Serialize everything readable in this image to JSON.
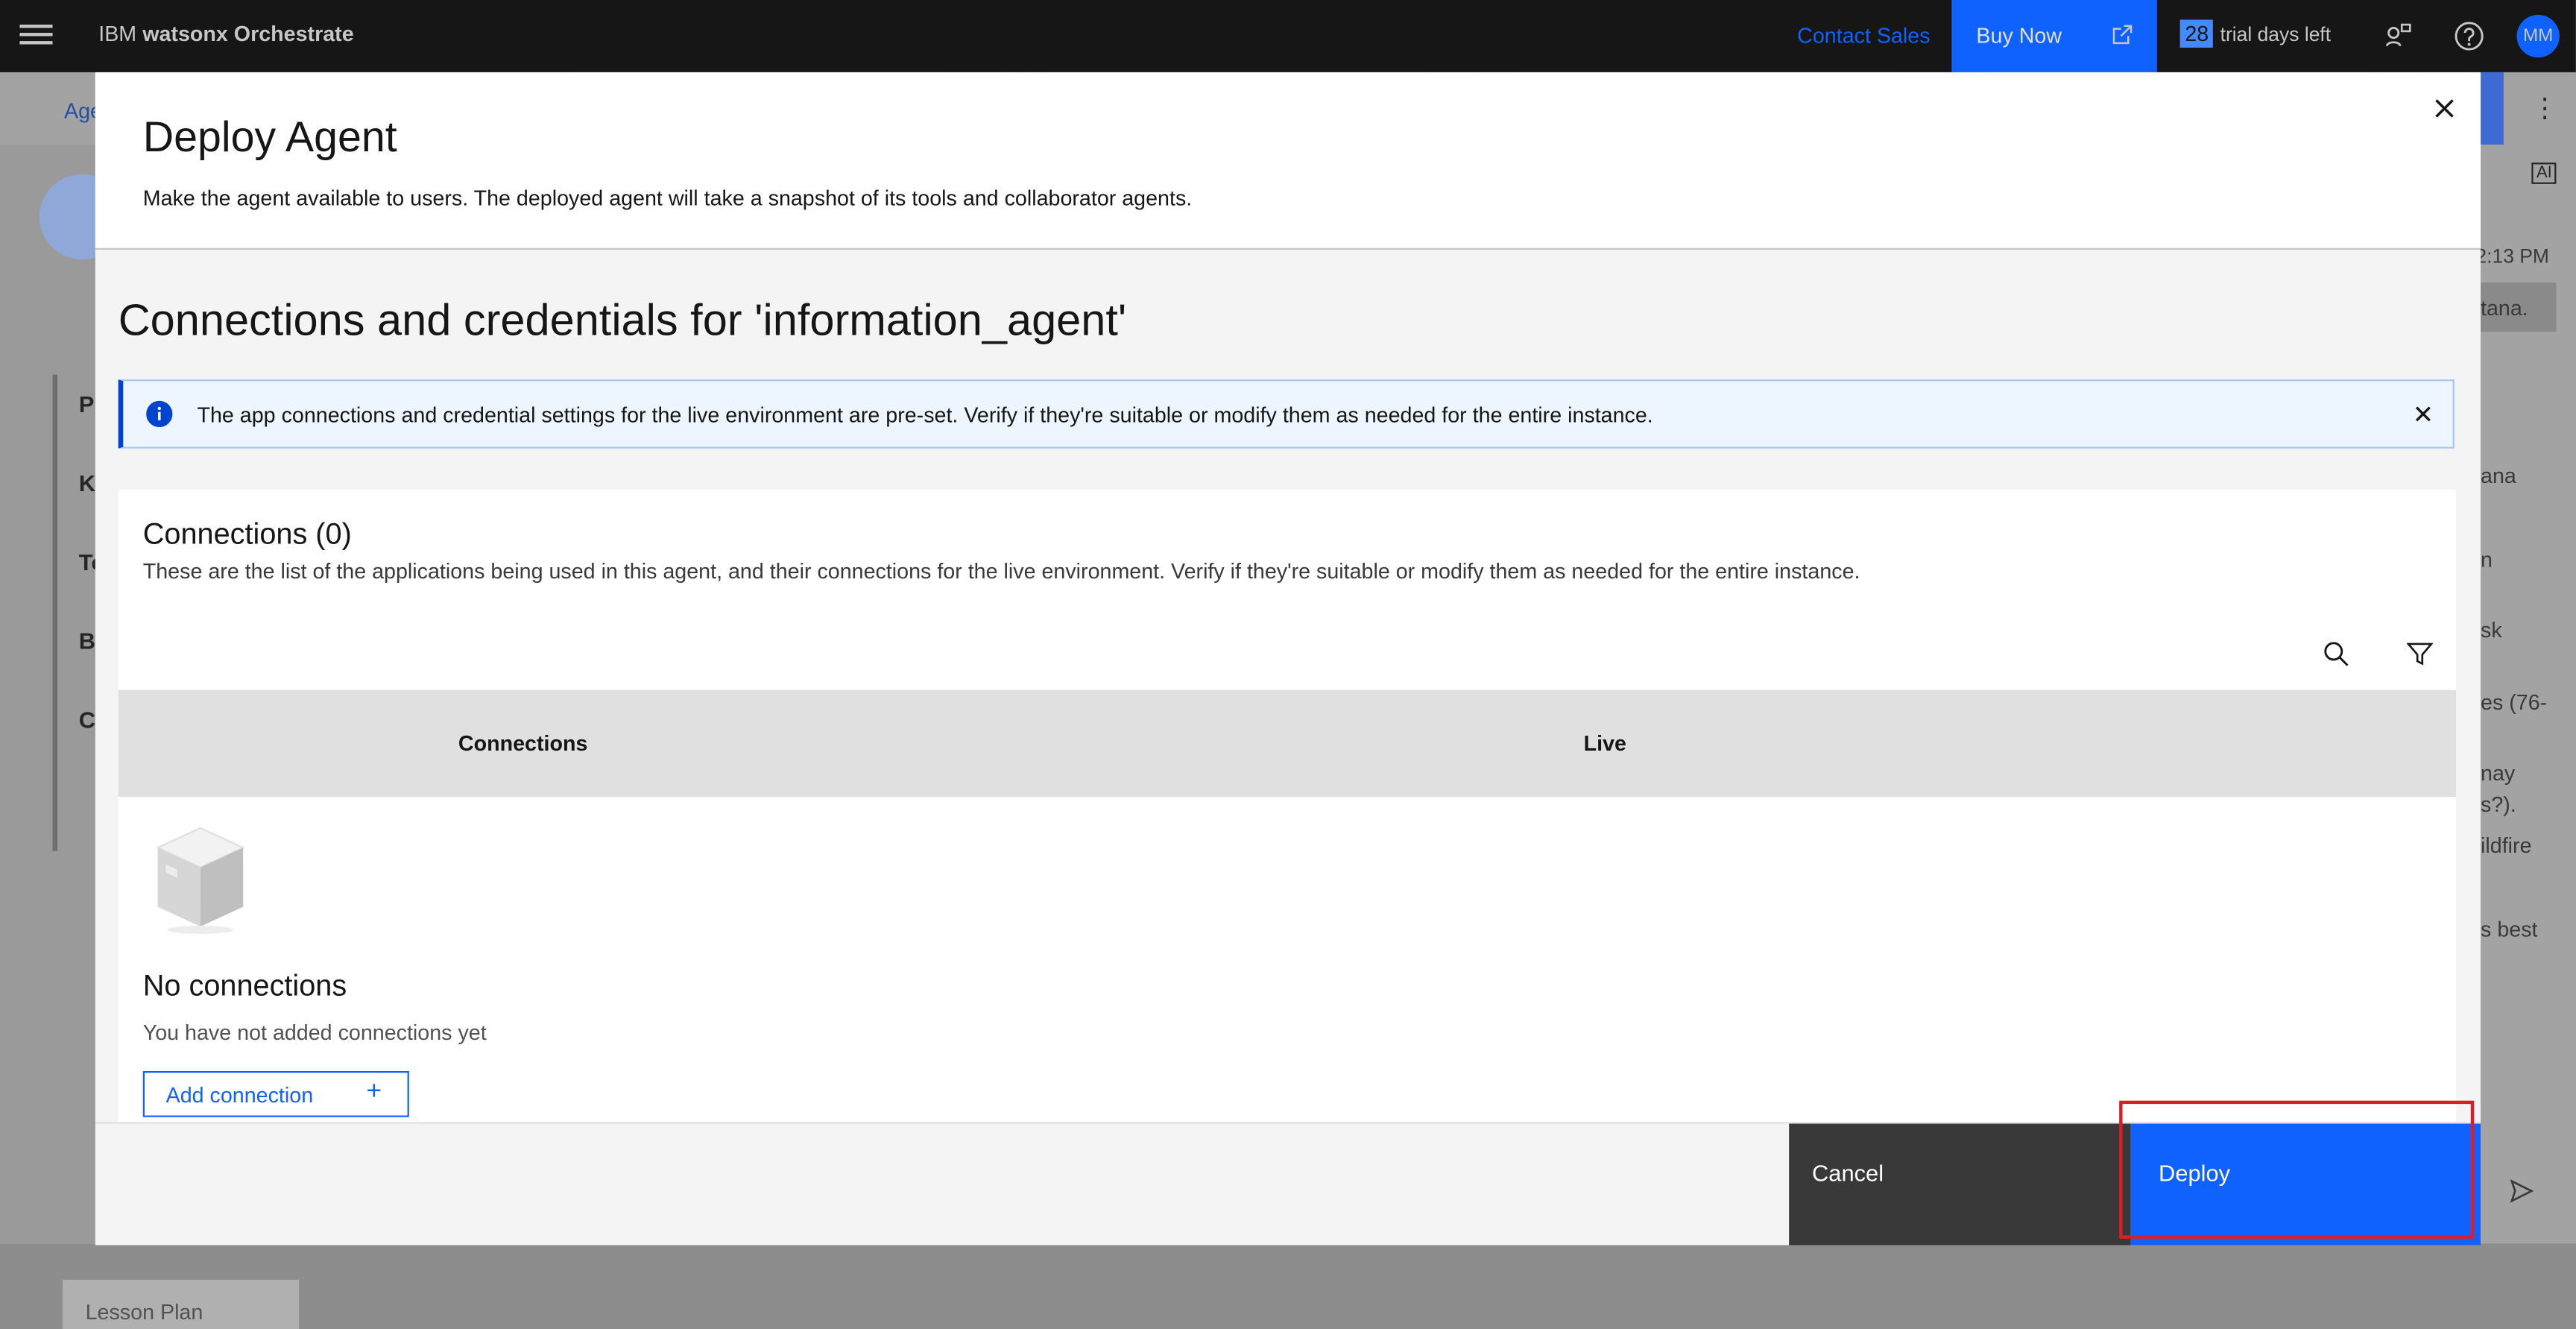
{
  "topbar": {
    "brand_prefix": "IBM",
    "brand_name": "watsonx Orchestrate",
    "contact_sales": "Contact Sales",
    "buy_now": "Buy Now",
    "trial_days": "28",
    "trial_text": "trial days left",
    "avatar_initials": "MM"
  },
  "background": {
    "crumb": "Age",
    "nav_items": [
      "P",
      "K",
      "To",
      "Be",
      "Cl"
    ],
    "right_snippets": [
      "2:13 PM",
      "tana.",
      "ana",
      "n",
      "sk",
      "es (76-",
      "nay",
      "s?).",
      "ildfire",
      "s best"
    ],
    "ai_badge": "AI",
    "lesson_tab": "Lesson Plan"
  },
  "modal": {
    "title": "Deploy Agent",
    "description": "Make the agent available to users. The deployed agent will take a snapshot of its tools and collaborator agents.",
    "section_title": "Connections and credentials for 'information_agent'",
    "notice": "The app connections and credential settings for the live environment are pre-set. Verify if they're suitable or modify them as needed for the entire instance.",
    "connections": {
      "heading": "Connections (0)",
      "description": "These are the list of the applications being used in this agent, and their connections for the live environment. Verify if they're suitable or modify them as needed for the entire instance.",
      "columns": [
        "Connections",
        "Live"
      ],
      "empty_title": "No connections",
      "empty_desc": "You have not added connections yet",
      "add_button": "Add connection",
      "add_icon": "+"
    },
    "footer": {
      "cancel": "Cancel",
      "deploy": "Deploy"
    }
  },
  "colors": {
    "primary": "#0f62fe",
    "shell": "#161616",
    "highlight": "#da1e28"
  }
}
